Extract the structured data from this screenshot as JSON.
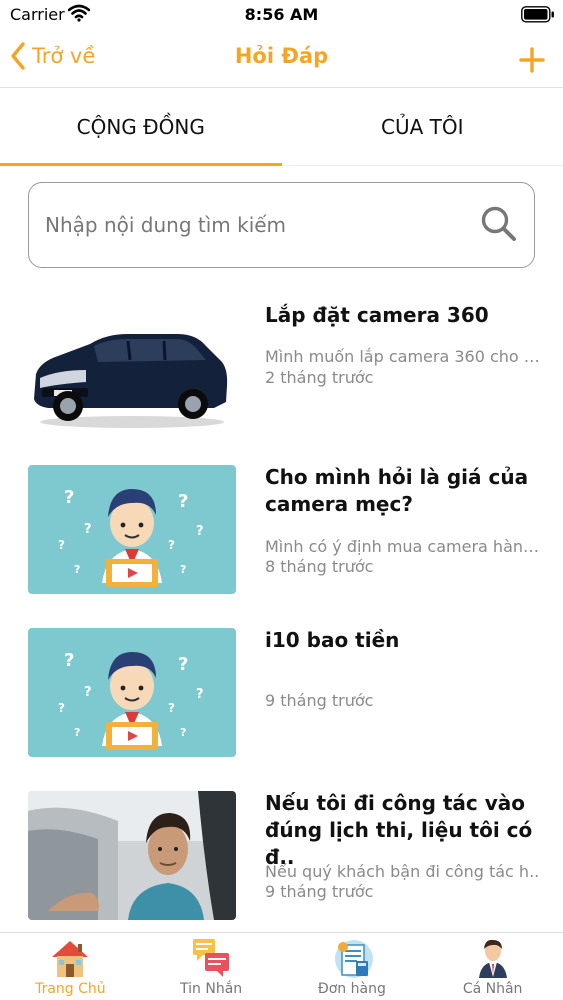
{
  "status_bar": {
    "carrier": "Carrier",
    "time": "8:56 AM"
  },
  "nav": {
    "back_label": "Trở về",
    "title": "Hỏi Đáp"
  },
  "tabs": [
    {
      "label": "CỘNG ĐỒNG",
      "active": true
    },
    {
      "label": "CỦA TÔI",
      "active": false
    }
  ],
  "search": {
    "placeholder": "Nhập nội dung tìm kiếm",
    "value": ""
  },
  "questions": [
    {
      "title": "Lắp đặt camera 360",
      "preview": "Mình muốn lắp camera 360 cho x..",
      "time": "2 tháng trước",
      "thumb": "car-image"
    },
    {
      "title": "Cho mình hỏi là giá của camera mẹc?",
      "preview": "Mình có ý định mua camera hành..",
      "time": "8 tháng trước",
      "thumb": "question-illustration"
    },
    {
      "title": "i10 bao tiền",
      "preview": "",
      "time": "9 tháng trước",
      "thumb": "question-illustration"
    },
    {
      "title": "Nếu tôi đi công tác vào đúng lịch thi, liệu tôi có đ..",
      "preview": "Nếu quý khách bận đi công tác h..",
      "time": "9 tháng trước",
      "thumb": "driver-photo"
    }
  ],
  "tab_bar": [
    {
      "label": "Trang Chủ",
      "icon": "home-icon",
      "active": true
    },
    {
      "label": "Tin Nhắn",
      "icon": "messages-icon",
      "active": false
    },
    {
      "label": "Đơn hàng",
      "icon": "orders-icon",
      "active": false
    },
    {
      "label": "Cá Nhân",
      "icon": "profile-icon",
      "active": false
    }
  ],
  "colors": {
    "accent": "#f5a524",
    "muted_text": "#8a8a8a",
    "thumb_bg": "#7ec8d0"
  }
}
